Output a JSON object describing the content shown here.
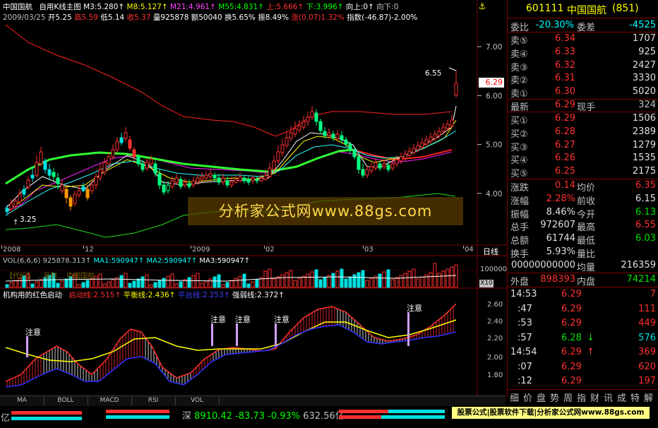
{
  "header": {
    "stock_name": "中国国航",
    "chart_mode": "自用K线主图",
    "ma_legend": [
      {
        "label": "M3:5.280",
        "color": "#ffffff"
      },
      {
        "label": "M8:5.127",
        "color": "#ffff00"
      },
      {
        "label": "M21:4.961",
        "color": "#ff40ff"
      },
      {
        "label": "M55:4.831",
        "color": "#00ff00"
      },
      {
        "label": "上:5.666",
        "color": "#ff3030"
      },
      {
        "label": "下:3.996",
        "color": "#00ff00"
      },
      {
        "label": "向上:0",
        "color": "#ffffff"
      },
      {
        "label": "向下:0",
        "color": "#c0c0c0"
      }
    ],
    "date": "2009/03/25",
    "open": "开5.25",
    "high": "高5.59",
    "low": "低5.14",
    "close": "收5.37",
    "volume": "量925878",
    "amount": "额50040",
    "turnover": "换5.65%",
    "amplitude": "振8.49%",
    "change": "涨(0.07)1.32%",
    "index": "指数(-46.87)-2.00%"
  },
  "price_axis": [
    "7.00",
    "6.00",
    "5.00",
    "4.00"
  ],
  "current_price_tag": "6.29",
  "annotations": {
    "high_label": "6.55",
    "low_label": "3.25"
  },
  "date_axis": [
    "2008",
    "12",
    "2009",
    "02",
    "03",
    "04"
  ],
  "period_label": "日线",
  "volume_panel": {
    "legend": [
      {
        "label": "VOL(6,6,6) 925878.313",
        "color": "#c0c0c0"
      },
      {
        "label": "MA1:590947",
        "color": "#00ffff"
      },
      {
        "label": "MA2:590947",
        "color": "#00ffff"
      },
      {
        "label": "MA3:590947",
        "color": "#ffffff"
      }
    ],
    "axis_label": "100000",
    "multiplier": "X10",
    "watermark_text": "【代码】 …名称… 中国国航"
  },
  "indicator_panel": {
    "title": "机构用的红色启动",
    "legend": [
      {
        "label": "启动线:2.515",
        "color": "#ff3030"
      },
      {
        "label": "平衡线:2.436",
        "color": "#ffff00"
      },
      {
        "label": "平台线:2.253",
        "color": "#4040ff"
      },
      {
        "label": "强弱线:2.372",
        "color": "#ffffff"
      }
    ],
    "axis": [
      "2.60",
      "2.40",
      "2.20",
      "2.00",
      "1.80"
    ],
    "notes": [
      "注意",
      "注意",
      "注意",
      "注意",
      "注意"
    ]
  },
  "watermark": "分析家公式网www.88gs.com",
  "quote_panel": {
    "code": "601111",
    "name": "中国国航",
    "index_no": "(851)",
    "weibi_label": "委比",
    "weibi_value": "-20.30%",
    "weicha_label": "委差",
    "weicha_value": "-4525",
    "sell": [
      {
        "label": "卖⑤",
        "price": "6.34",
        "vol": "1707"
      },
      {
        "label": "卖④",
        "price": "6.33",
        "vol": "925"
      },
      {
        "label": "卖③",
        "price": "6.32",
        "vol": "2427"
      },
      {
        "label": "卖②",
        "price": "6.31",
        "vol": "3330"
      },
      {
        "label": "卖①",
        "price": "6.30",
        "vol": "5020"
      }
    ],
    "latest_label": "最新",
    "latest_value": "6.29",
    "xianshou_label": "现手",
    "xianshou_value": "324",
    "buy": [
      {
        "label": "买①",
        "price": "6.29",
        "vol": "1506"
      },
      {
        "label": "买②",
        "price": "6.28",
        "vol": "2389"
      },
      {
        "label": "买③",
        "price": "6.27",
        "vol": "1279"
      },
      {
        "label": "买④",
        "price": "6.26",
        "vol": "1535"
      },
      {
        "label": "买⑤",
        "price": "6.25",
        "vol": "2175"
      }
    ],
    "stats": [
      {
        "l1": "涨跌",
        "v1": "0.14",
        "c1": "red",
        "l2": "均价",
        "v2": "6.35",
        "c2": "red"
      },
      {
        "l1": "涨幅",
        "v1": "2.28%",
        "c1": "red",
        "l2": "前收",
        "v2": "6.15",
        "c2": "wht"
      },
      {
        "l1": "振幅",
        "v1": "8.46%",
        "c1": "wht",
        "l2": "今开",
        "v2": "6.13",
        "c2": "grn"
      },
      {
        "l1": "总手",
        "v1": "972607",
        "c1": "wht",
        "l2": "最高",
        "v2": "6.55",
        "c2": "red"
      },
      {
        "l1": "总额",
        "v1": "61744",
        "c1": "wht",
        "l2": "最低",
        "v2": "6.03",
        "c2": "grn"
      },
      {
        "l1": "换手",
        "v1": "5.93%",
        "c1": "wht",
        "l2": "量比",
        "v2": "",
        "c2": "wht"
      },
      {
        "l1": "",
        "v1": "00000000000",
        "c1": "wht",
        "l2": "均量",
        "v2": "216359",
        "c2": "wht"
      }
    ],
    "waipan_label": "外盘",
    "waipan_value": "898393",
    "neipan_label": "内盘",
    "neipan_value": "74214",
    "ticks": [
      {
        "time": "14:53",
        "price": "6.29",
        "vol": "7",
        "arrow": ""
      },
      {
        "time": ":47",
        "price": "6.29",
        "vol": "111",
        "arrow": ""
      },
      {
        "time": ":53",
        "price": "6.29",
        "vol": "449",
        "arrow": ""
      },
      {
        "time": ":57",
        "price": "6.28",
        "vol": "576",
        "arrow": "↓"
      },
      {
        "time": "14:54",
        "price": "6.29",
        "vol": "369",
        "arrow": "↑"
      },
      {
        "time": ":07",
        "price": "6.29",
        "vol": "620",
        "arrow": ""
      },
      {
        "time": ":12",
        "price": "6.29",
        "vol": "197",
        "arrow": ""
      }
    ],
    "bottom_buttons": [
      "细",
      "价",
      "盘",
      "势",
      "周",
      "指",
      "财",
      "讯",
      "成",
      "特",
      "解"
    ]
  },
  "indicator_tabs": [
    "MA",
    "BOLL",
    "MACD",
    "RSI",
    "VOL"
  ],
  "status_bar": {
    "left_unit": "亿",
    "market": "深",
    "index_value": "8910.42",
    "index_change": "-83.73",
    "index_pct": "-0.93%",
    "amount": "632.56亿",
    "ad_banner": "股票公式|股票软件下载|分析家公式网www.88gs.com"
  }
}
